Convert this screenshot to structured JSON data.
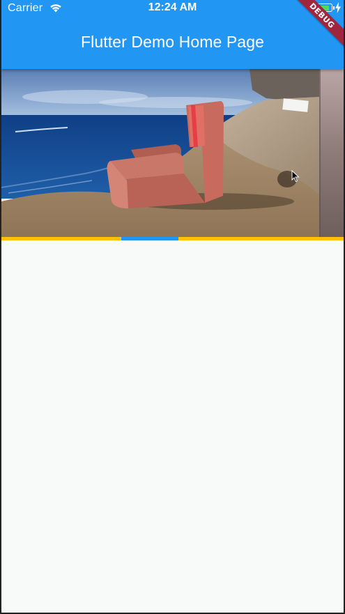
{
  "status_bar": {
    "carrier": "Carrier",
    "time": "12:24 AM",
    "wifi_icon": "wifi-icon",
    "battery_icon": "battery-icon",
    "charging_icon": "bolt-icon"
  },
  "app_bar": {
    "title": "Flutter Demo Home Page",
    "color": "#2196f3"
  },
  "debug_banner": {
    "label": "DEBUG",
    "color": "#a0263e"
  },
  "carousel": {
    "slides": [
      {
        "image": "armchair-on-cliff-photo"
      },
      {
        "image": "next-slide-photo"
      }
    ],
    "indicator": {
      "count": 6,
      "active_index": 2,
      "active_color": "#2196f3",
      "inactive_color": "#ffc107"
    }
  },
  "colors": {
    "background": "#f8f9f9"
  }
}
